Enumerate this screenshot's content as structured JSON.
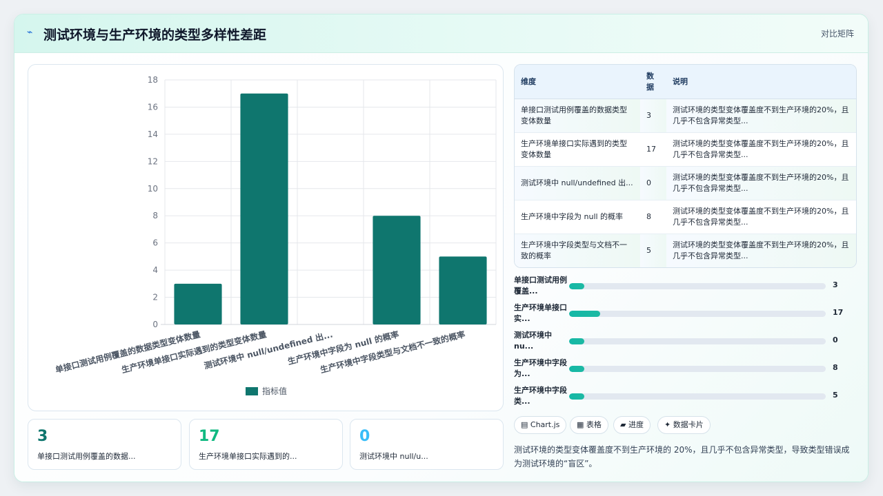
{
  "header": {
    "icon": "sparkline-icon",
    "icon_glyph": "⌁",
    "title": "测试环境与生产环境的类型多样性差距",
    "badge": "对比矩阵"
  },
  "chart_data": {
    "type": "bar",
    "categories": [
      "单接口测试用例覆盖的数据类型变体数量",
      "生产环境单接口实际遇到的类型变体数量",
      "测试环境中 null/undefined 出...",
      "生产环境中字段为 null 的概率",
      "生产环境中字段类型与文档不一致的概率"
    ],
    "series": [
      {
        "name": "指标值",
        "values": [
          3,
          17,
          0,
          8,
          5
        ],
        "color": "#0f766e"
      }
    ],
    "ylim": [
      0,
      18
    ],
    "yticks": [
      "0",
      "2",
      "4",
      "6",
      "8",
      "10",
      "12",
      "14",
      "16",
      "18"
    ],
    "grid": true,
    "legend": "bottom"
  },
  "stats": [
    {
      "value": "3",
      "label": "单接口测试用例覆盖的数据...",
      "color": "#0f766e"
    },
    {
      "value": "17",
      "label": "生产环境单接口实际遇到的...",
      "color": "#10b981"
    },
    {
      "value": "0",
      "label": "测试环境中 null/u...",
      "color": "#38bdf8"
    }
  ],
  "table": {
    "headers": [
      "维度",
      "数据",
      "说明"
    ],
    "rows": [
      {
        "dim": "单接口测试用例覆盖的数据类型变体数量",
        "val": "3",
        "desc": "测试环境的类型变体覆盖度不到生产环境的20%，且几乎不包含异常类型..."
      },
      {
        "dim": "生产环境单接口实际遇到的类型变体数量",
        "val": "17",
        "desc": "测试环境的类型变体覆盖度不到生产环境的20%，且几乎不包含异常类型..."
      },
      {
        "dim": "测试环境中 null/undefined 出...",
        "val": "0",
        "desc": "测试环境的类型变体覆盖度不到生产环境的20%，且几乎不包含异常类型..."
      },
      {
        "dim": "生产环境中字段为 null 的概率",
        "val": "8",
        "desc": "测试环境的类型变体覆盖度不到生产环境的20%，且几乎不包含异常类型..."
      },
      {
        "dim": "生产环境中字段类型与文档不一致的概率",
        "val": "5",
        "desc": "测试环境的类型变体覆盖度不到生产环境的20%，且几乎不包含异常类型..."
      }
    ]
  },
  "progress": [
    {
      "label": "单接口测试用例覆盖...",
      "value": "3",
      "ratio": 0.06
    },
    {
      "label": "生产环境单接口实...",
      "value": "17",
      "ratio": 0.12
    },
    {
      "label": "测试环境中 nu...",
      "value": "0",
      "ratio": 0.06
    },
    {
      "label": "生产环境中字段为...",
      "value": "8",
      "ratio": 0.06
    },
    {
      "label": "生产环境中字段类...",
      "value": "5",
      "ratio": 0.06
    }
  ],
  "chips": [
    {
      "icon": "chart-icon",
      "label": "▤ Chart.js"
    },
    {
      "icon": "table-icon",
      "label": "▦ 表格"
    },
    {
      "icon": "progress-icon",
      "label": "▰ 进度"
    },
    {
      "icon": "sparkle-icon",
      "label": "✦ 数据卡片"
    }
  ],
  "summary": "测试环境的类型变体覆盖度不到生产环境的 20%，且几乎不包含异常类型，导致类型错误成为测试环境的“盲区”。"
}
